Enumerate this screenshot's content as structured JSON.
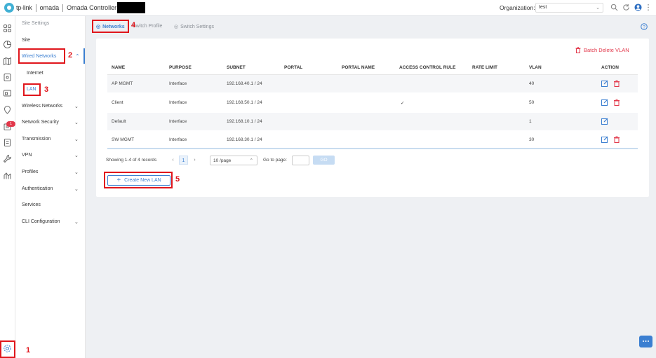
{
  "topbar": {
    "brand": "tp-link",
    "product": "omada",
    "controller_title": "Omada Controller",
    "organization_label": "Organization:",
    "organization_value": "test"
  },
  "sidebar": {
    "header": "Site Settings",
    "items": [
      {
        "label": "Site"
      },
      {
        "label": "Wired Networks"
      },
      {
        "label": "Internet"
      },
      {
        "label": "LAN"
      },
      {
        "label": "Wireless Networks"
      },
      {
        "label": "Network Security"
      },
      {
        "label": "Transmission"
      },
      {
        "label": "VPN"
      },
      {
        "label": "Profiles"
      },
      {
        "label": "Authentication"
      },
      {
        "label": "Services"
      },
      {
        "label": "CLI Configuration"
      }
    ]
  },
  "leftnav": {
    "notification_badge": "1"
  },
  "tabs": [
    {
      "label": "Networks"
    },
    {
      "label": "Switch Profile"
    },
    {
      "label": "Switch Settings"
    }
  ],
  "annotations": [
    "1",
    "2",
    "3",
    "4",
    "5"
  ],
  "table": {
    "batch_delete_label": "Batch Delete VLAN",
    "columns": [
      "NAME",
      "PURPOSE",
      "SUBNET",
      "PORTAL",
      "PORTAL NAME",
      "ACCESS CONTROL RULE",
      "RATE LIMIT",
      "VLAN",
      "ACTION"
    ],
    "rows": [
      {
        "name": "AP MGMT",
        "purpose": "Interface",
        "subnet": "192.168.40.1 / 24",
        "acl": "",
        "vlan": "40"
      },
      {
        "name": "Client",
        "purpose": "Interface",
        "subnet": "192.168.50.1 / 24",
        "acl": "✓",
        "vlan": "50"
      },
      {
        "name": "Default",
        "purpose": "Interface",
        "subnet": "192.168.10.1 / 24",
        "acl": "",
        "vlan": "1"
      },
      {
        "name": "SW MGMT",
        "purpose": "Interface",
        "subnet": "192.168.30.1 / 24",
        "acl": "",
        "vlan": "30"
      }
    ],
    "showing_text": "Showing 1-4 of 4 records",
    "current_page": "1",
    "per_page": "10 /page",
    "goto_label": "Go to page:",
    "go_button": "GO"
  },
  "create_button_label": "Create New LAN",
  "colors": {
    "accent": "#3b7fd1",
    "danger": "#e2374a",
    "annotation_red": "#e0161c"
  }
}
